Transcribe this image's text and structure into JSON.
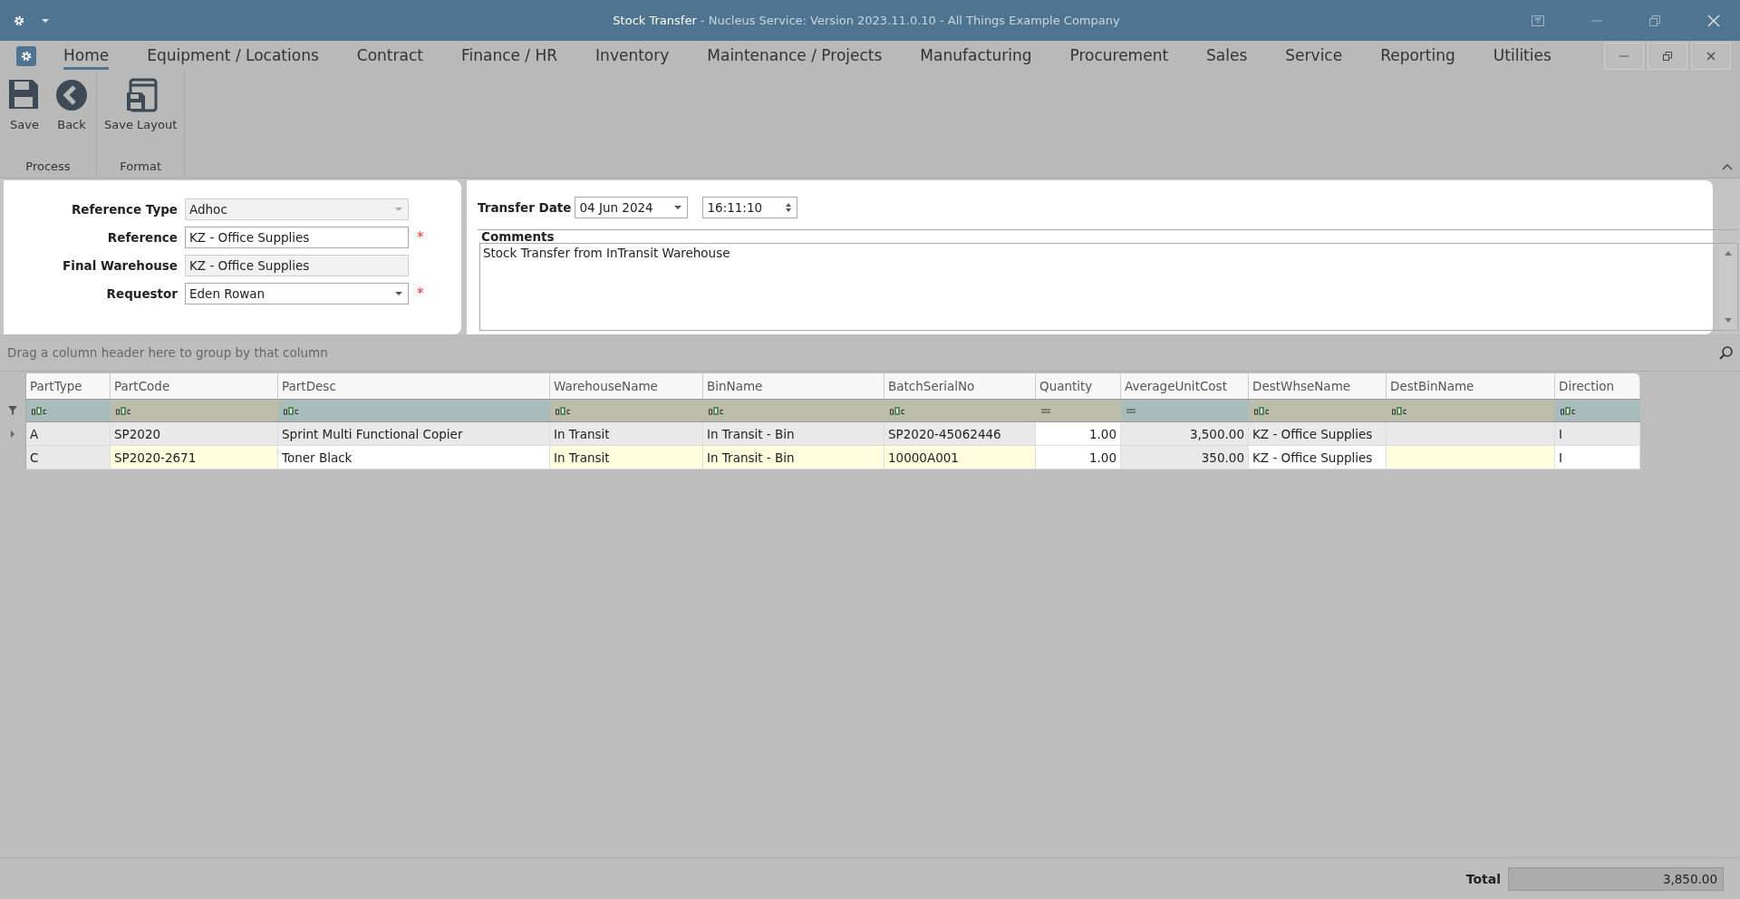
{
  "window": {
    "title": "Stock Transfer",
    "subtitle": " - Nucleus Service: Version 2023.11.0.10 - All Things Example Company"
  },
  "menu": [
    {
      "label": "Home",
      "selected": true
    },
    {
      "label": "Equipment / Locations",
      "selected": false
    },
    {
      "label": "Contract",
      "selected": false
    },
    {
      "label": "Finance / HR",
      "selected": false
    },
    {
      "label": "Inventory",
      "selected": false
    },
    {
      "label": "Maintenance / Projects",
      "selected": false
    },
    {
      "label": "Manufacturing",
      "selected": false
    },
    {
      "label": "Procurement",
      "selected": false
    },
    {
      "label": "Sales",
      "selected": false
    },
    {
      "label": "Service",
      "selected": false
    },
    {
      "label": "Reporting",
      "selected": false
    },
    {
      "label": "Utilities",
      "selected": false
    }
  ],
  "ribbon": [
    {
      "group": "Process",
      "buttons": [
        {
          "label": "Save",
          "kind": "save"
        },
        {
          "label": "Back",
          "kind": "back"
        }
      ]
    },
    {
      "group": "Format",
      "buttons": [
        {
          "label": "Save Layout",
          "kind": "layout"
        }
      ]
    }
  ],
  "required_marker": "*",
  "form": [
    {
      "label": "Reference Type",
      "value": "Adhoc",
      "kind": "dropdown",
      "disabled": true,
      "required": false
    },
    {
      "label": "Reference",
      "value": "KZ - Office Supplies",
      "kind": "text",
      "disabled": false,
      "required": true
    },
    {
      "label": "Final Warehouse",
      "value": "KZ - Office Supplies",
      "kind": "text",
      "disabled": true,
      "required": false
    },
    {
      "label": "Requestor",
      "value": "Eden Rowan",
      "kind": "dropdown",
      "disabled": false,
      "required": true
    }
  ],
  "transfer": {
    "label": "Transfer Date",
    "date": "04 Jun 2024",
    "time": "16:11:10"
  },
  "comments": {
    "label": "Comments",
    "value": "Stock Transfer from InTransit Warehouse"
  },
  "group_panel": {
    "placeholder": "Drag a column header here to group by that column"
  },
  "table": {
    "columns": [
      {
        "name": "PartType",
        "kind": "readonly",
        "numeric": false,
        "color": "#a9bcbc"
      },
      {
        "name": "PartCode",
        "kind": "required",
        "numeric": false,
        "color": "#bcbcaa"
      },
      {
        "name": "PartDesc",
        "kind": "plain",
        "numeric": false,
        "color": "#a9bcbc"
      },
      {
        "name": "WarehouseName",
        "kind": "required",
        "numeric": false,
        "color": "#bcbcaa"
      },
      {
        "name": "BinName",
        "kind": "required",
        "numeric": false,
        "color": "#bcbcaa"
      },
      {
        "name": "BatchSerialNo",
        "kind": "required",
        "numeric": false,
        "color": "#bcbcaa"
      },
      {
        "name": "Quantity",
        "kind": "editable",
        "numeric": true,
        "color": "#bcbcaa"
      },
      {
        "name": "AverageUnitCost",
        "kind": "readonly",
        "numeric": true,
        "color": "#a9bcbc"
      },
      {
        "name": "DestWhseName",
        "kind": "plain",
        "numeric": false,
        "color": "#bcbcaa"
      },
      {
        "name": "DestBinName",
        "kind": "required",
        "numeric": false,
        "color": "#bcbcaa"
      },
      {
        "name": "Direction",
        "kind": "plain",
        "numeric": false,
        "color": "#a9bcbc"
      }
    ],
    "rows": [
      {
        "selected": true,
        "cells": [
          "A",
          "SP2020",
          "Sprint Multi Functional Copier",
          "In Transit",
          "In Transit - Bin",
          "SP2020-45062446",
          "1.00",
          "3,500.00",
          "KZ - Office Supplies",
          "",
          "I"
        ]
      },
      {
        "selected": false,
        "cells": [
          "C",
          "SP2020-2671",
          "Toner Black",
          "In Transit",
          "In Transit - Bin",
          "10000A001",
          "1.00",
          "350.00",
          "KZ - Office Supplies",
          "",
          "I"
        ]
      }
    ]
  },
  "footer": {
    "label": "Total",
    "value": "3,850.00"
  }
}
